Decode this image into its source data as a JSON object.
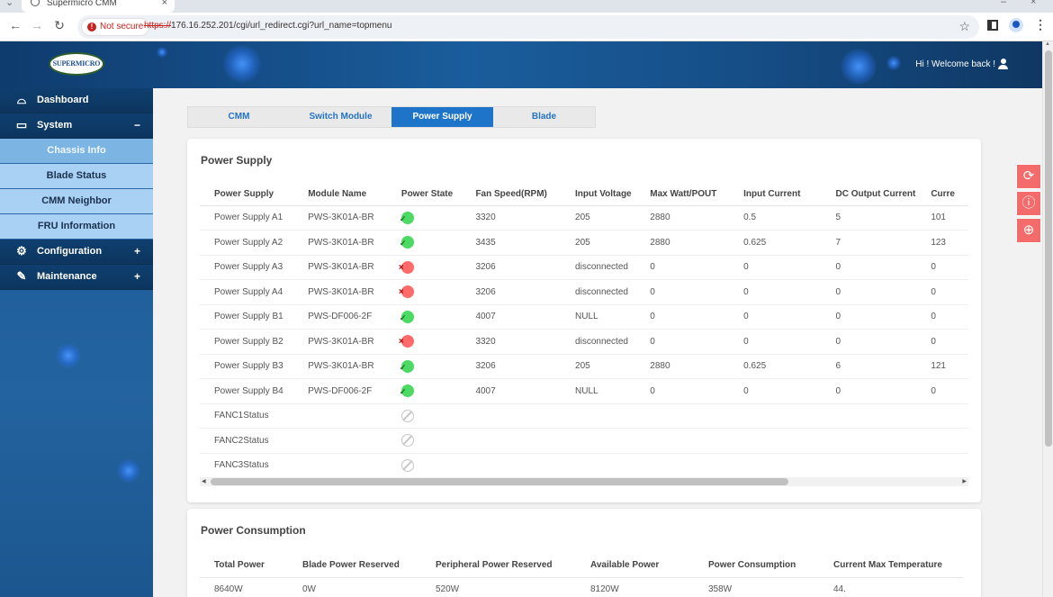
{
  "browser": {
    "tab_title": "Supermicro CMM",
    "security_label": "Not secure",
    "url_protocol": "https://",
    "url_rest": "176.16.252.201/cgi/url_redirect.cgi?url_name=topmenu"
  },
  "header": {
    "logo_text": "SUPERMICRO",
    "welcome": "Hi ! Welcome back !"
  },
  "sidebar": {
    "dashboard": "Dashboard",
    "system": "System",
    "system_toggle": "−",
    "sub_items": [
      "Chassis Info",
      "Blade Status",
      "CMM Neighbor",
      "FRU Information"
    ],
    "configuration": "Configuration",
    "maintenance": "Maintenance",
    "expand_toggle": "+"
  },
  "tabs": [
    "CMM",
    "Switch Module",
    "Power Supply",
    "Blade"
  ],
  "power_supply": {
    "title": "Power Supply",
    "columns": [
      "Power Supply",
      "Module Name",
      "Power State",
      "Fan Speed(RPM)",
      "Input Voltage",
      "Max Watt/POUT",
      "Input Current",
      "DC Output Current",
      "Curre"
    ],
    "rows": [
      {
        "name": "Power Supply A1",
        "module": "PWS-3K01A-BR",
        "state": "ok",
        "fan": "3320",
        "voltage": "205",
        "watt": "2880",
        "input_current": "0.5",
        "dc_output": "5",
        "current": "101"
      },
      {
        "name": "Power Supply A2",
        "module": "PWS-3K01A-BR",
        "state": "ok",
        "fan": "3435",
        "voltage": "205",
        "watt": "2880",
        "input_current": "0.625",
        "dc_output": "7",
        "current": "123"
      },
      {
        "name": "Power Supply A3",
        "module": "PWS-3K01A-BR",
        "state": "bad",
        "fan": "3206",
        "voltage": "disconnected",
        "watt": "0",
        "input_current": "0",
        "dc_output": "0",
        "current": "0"
      },
      {
        "name": "Power Supply A4",
        "module": "PWS-3K01A-BR",
        "state": "bad",
        "fan": "3206",
        "voltage": "disconnected",
        "watt": "0",
        "input_current": "0",
        "dc_output": "0",
        "current": "0"
      },
      {
        "name": "Power Supply B1",
        "module": "PWS-DF006-2F",
        "state": "ok",
        "fan": "4007",
        "voltage": "NULL",
        "watt": "0",
        "input_current": "0",
        "dc_output": "0",
        "current": "0"
      },
      {
        "name": "Power Supply B2",
        "module": "PWS-3K01A-BR",
        "state": "bad",
        "fan": "3320",
        "voltage": "disconnected",
        "watt": "0",
        "input_current": "0",
        "dc_output": "0",
        "current": "0"
      },
      {
        "name": "Power Supply B3",
        "module": "PWS-3K01A-BR",
        "state": "ok",
        "fan": "3206",
        "voltage": "205",
        "watt": "2880",
        "input_current": "0.625",
        "dc_output": "6",
        "current": "121"
      },
      {
        "name": "Power Supply B4",
        "module": "PWS-DF006-2F",
        "state": "ok",
        "fan": "4007",
        "voltage": "NULL",
        "watt": "0",
        "input_current": "0",
        "dc_output": "0",
        "current": "0"
      },
      {
        "name": "FANC1Status",
        "module": "",
        "state": "na",
        "fan": "",
        "voltage": "",
        "watt": "",
        "input_current": "",
        "dc_output": "",
        "current": ""
      },
      {
        "name": "FANC2Status",
        "module": "",
        "state": "na",
        "fan": "",
        "voltage": "",
        "watt": "",
        "input_current": "",
        "dc_output": "",
        "current": ""
      },
      {
        "name": "FANC3Status",
        "module": "",
        "state": "na",
        "fan": "",
        "voltage": "",
        "watt": "",
        "input_current": "",
        "dc_output": "",
        "current": ""
      }
    ]
  },
  "power_consumption": {
    "title": "Power Consumption",
    "columns": [
      "Total Power",
      "Blade Power Reserved",
      "Peripheral Power Reserved",
      "Available Power",
      "Power Consumption",
      "Current Max Temperature"
    ],
    "values": [
      "8640W",
      "0W",
      "520W",
      "8120W",
      "358W",
      "44."
    ]
  },
  "colors": {
    "accent": "#1e74c8",
    "ok": "#4cd964",
    "bad": "#ff6b6b",
    "float_button": "#f36b6b"
  },
  "icons": {
    "refresh": "refresh-icon",
    "info": "info-icon",
    "language": "globe-icon"
  }
}
